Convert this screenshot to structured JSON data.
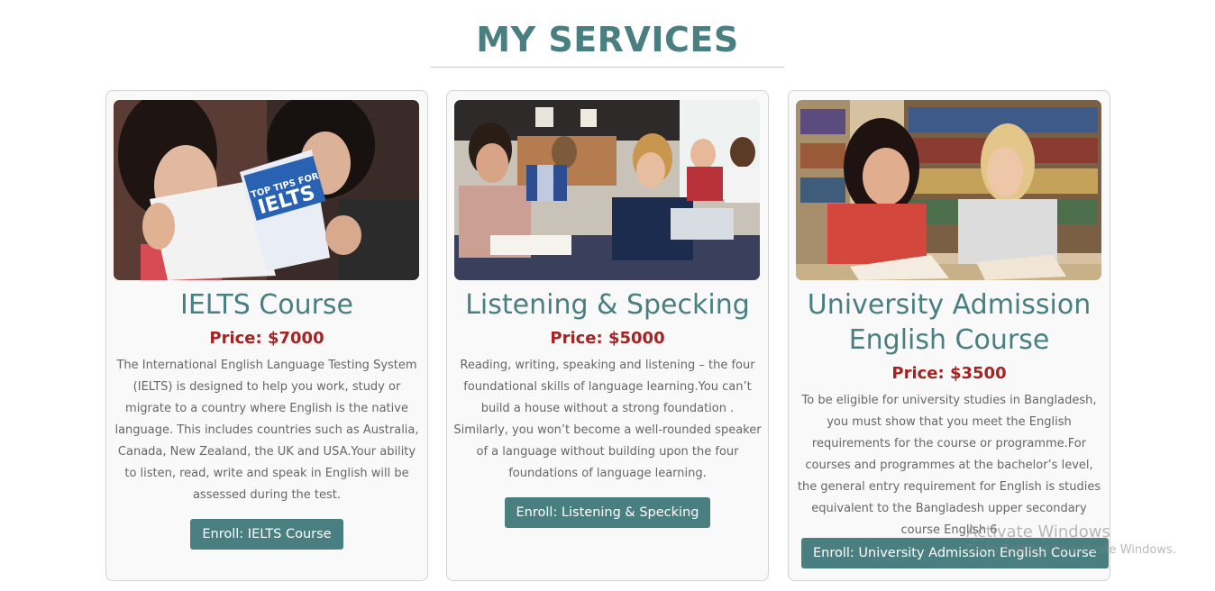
{
  "section": {
    "title": "MY SERVICES"
  },
  "cards": [
    {
      "title": "IELTS Course",
      "price": "Price: $7000",
      "description": "The International English Language Testing System (IELTS) is designed to help you work, study or migrate to a country where English is the native language. This includes countries such as Australia, Canada, New Zealand, the UK and USA.Your ability to listen, read, write and speak in English will be assessed during the test.",
      "button": "Enroll: IELTS Course",
      "image_text": [
        "TOP TIPS FOR",
        "IELTS"
      ]
    },
    {
      "title": "Listening & Specking",
      "price": "Price: $5000",
      "description": "Reading, writing, speaking and listening – the four foundational skills of language learning.You can’t build a house without a strong foundation . Similarly, you won’t become a well-rounded speaker of a language without building upon the four foundations of language learning.",
      "button": "Enroll: Listening & Specking"
    },
    {
      "title": "University Admission English Course",
      "price": "Price: $3500",
      "description": "To be eligible for university studies in Bangladesh, you must show that you meet the English requirements for the course or programme.For courses and programmes at the bachelor’s level, the general entry requirement for English is studies equivalent to the Bangladesh upper secondary course English 6",
      "button": "Enroll: University Admission English Course"
    }
  ],
  "watermark": {
    "line1": "Activate Windows",
    "line2": "Go to Settings to activate Windows."
  },
  "colors": {
    "accent": "#4a7f82",
    "price": "#a52323",
    "card_border": "#d3d3d3"
  }
}
